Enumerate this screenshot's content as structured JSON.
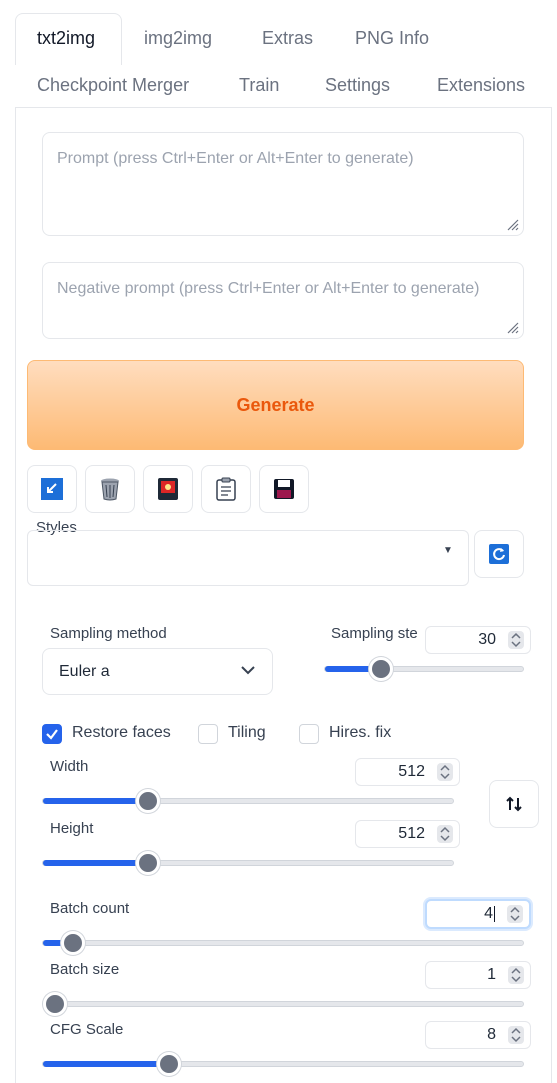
{
  "tabs": {
    "row1": [
      "txt2img",
      "img2img",
      "Extras",
      "PNG Info"
    ],
    "row2": [
      "Checkpoint Merger",
      "Train",
      "Settings",
      "Extensions"
    ]
  },
  "prompt": {
    "placeholder": "Prompt (press Ctrl+Enter or Alt+Enter to generate)"
  },
  "negative_prompt": {
    "placeholder": "Negative prompt (press Ctrl+Enter or Alt+Enter to generate)"
  },
  "generate": {
    "label": "Generate",
    "color": "#ea580c"
  },
  "tools": [
    "arrow-icon",
    "trash-icon",
    "card-icon",
    "clipboard-icon",
    "save-icon"
  ],
  "styles": {
    "label": "Styles",
    "value": ""
  },
  "sampling": {
    "method_label": "Sampling method",
    "method_value": "Euler a",
    "steps_label": "Sampling ste",
    "steps_value": "30",
    "steps_fraction": 0.25
  },
  "checkboxes": {
    "restore_faces": {
      "label": "Restore faces",
      "checked": true
    },
    "tiling": {
      "label": "Tiling",
      "checked": false
    },
    "hires_fix": {
      "label": "Hires. fix",
      "checked": false
    }
  },
  "width": {
    "label": "Width",
    "value": "512",
    "fraction": 0.24
  },
  "height": {
    "label": "Height",
    "value": "512",
    "fraction": 0.24
  },
  "batch_count": {
    "label": "Batch count",
    "value": "4",
    "fraction": 0.04
  },
  "batch_size": {
    "label": "Batch size",
    "value": "1",
    "fraction": 0.0
  },
  "cfg_scale": {
    "label": "CFG Scale",
    "value": "8",
    "fraction": 0.25
  },
  "accent_color": "#2563eb"
}
